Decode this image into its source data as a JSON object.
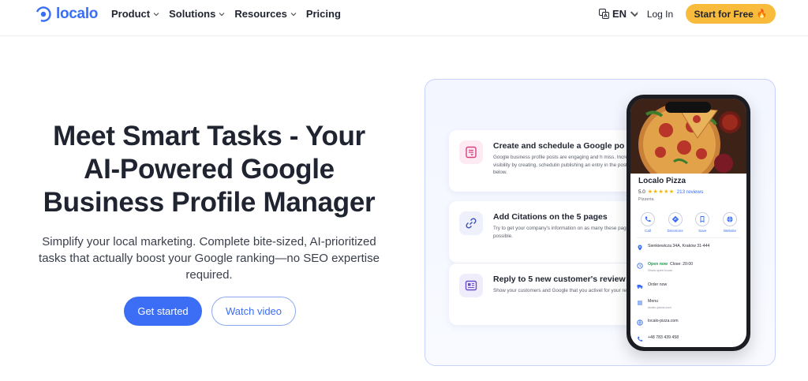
{
  "header": {
    "logo_text": "localo",
    "nav": [
      {
        "label": "Product",
        "dropdown": true
      },
      {
        "label": "Solutions",
        "dropdown": true
      },
      {
        "label": "Resources",
        "dropdown": true
      },
      {
        "label": "Pricing",
        "dropdown": false
      }
    ],
    "language": "EN",
    "login_label": "Log In",
    "cta_label": "Start for Free",
    "cta_icon": "fire-icon"
  },
  "hero": {
    "title_lines": [
      "Meet Smart Tasks - Your",
      "AI-Powered Google",
      "Business Profile Manager"
    ],
    "subtitle": "Simplify your local marketing. Complete bite-sized, AI-prioritized tasks that actually boost your Google ranking—no SEO expertise required.",
    "primary_button": "Get started",
    "secondary_button": "Watch video"
  },
  "tasks": [
    {
      "icon": "post-calendar-icon",
      "title": "Create and schedule a Google po",
      "desc": "Google business profile posts are engaging and h miss. Increase your visibility by creating, schedulin publishing an entry in the post planner below."
    },
    {
      "icon": "link-icon",
      "title": "Add Citations on the 5 pages",
      "desc": "Try to get your company's information on as many these pages as possible."
    },
    {
      "icon": "review-icon",
      "title": "Reply to 5 new customer's review",
      "desc": "Show your customers and Google that you activel for your reputation."
    }
  ],
  "phone": {
    "business_name": "Localo Pizza",
    "rating": "5.0",
    "stars": "★★★★★",
    "reviews": "213 reviews",
    "category": "Pizzeria",
    "actions": [
      {
        "label": "Call",
        "icon": "phone-icon"
      },
      {
        "label": "Directions",
        "icon": "directions-icon"
      },
      {
        "label": "Save",
        "icon": "bookmark-icon"
      },
      {
        "label": "Website",
        "icon": "globe-icon"
      }
    ],
    "address": "Sienkiewicza 34A, Kraków 31-444",
    "open_status": "Open now",
    "close_time": "Close: 20:00",
    "hours_link": "Show open hours",
    "order": "Order now",
    "menu": "Menu",
    "menu_url": "localo-pizza.com",
    "website": "localo-pizza.com",
    "phone_number": "+48 783 439 458"
  },
  "colors": {
    "brand_blue": "#3b6ef5",
    "cta_yellow": "#f8bb3c",
    "text_dark": "#1f2430"
  }
}
